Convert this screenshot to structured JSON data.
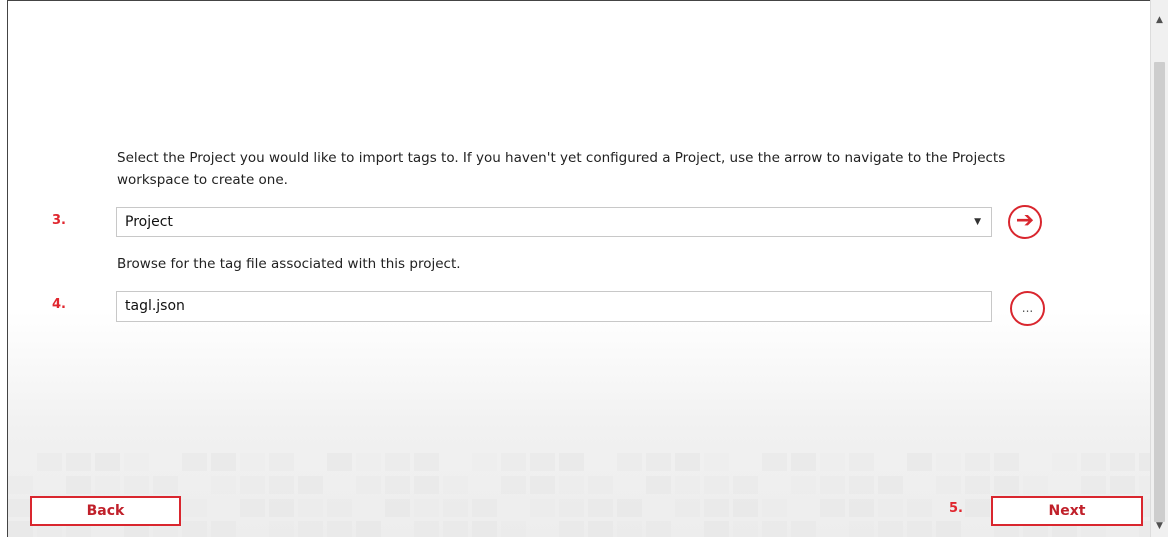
{
  "instruction_text": "Select the Project you would like to import tags to. If you haven't  yet configured a Project, use the arrow to navigate to the Projects workspace to create one.",
  "steps": {
    "project_step": "3.",
    "file_step": "4.",
    "next_step": "5."
  },
  "project_select": {
    "value": "Project",
    "caret": "▼"
  },
  "navigate_button": {
    "icon": "arrow-right-circle-icon",
    "glyph": "➔"
  },
  "browse_label": "Browse for the tag file associated with this project.",
  "tag_file_input": {
    "value": "tagl.json"
  },
  "browse_button": {
    "label": "..."
  },
  "footer": {
    "back_label": "Back",
    "next_label": "Next"
  },
  "scrollbar": {
    "up_glyph": "▲",
    "down_glyph": "▼"
  },
  "colors": {
    "accent": "#d9262e",
    "step_number": "#e0262e"
  }
}
